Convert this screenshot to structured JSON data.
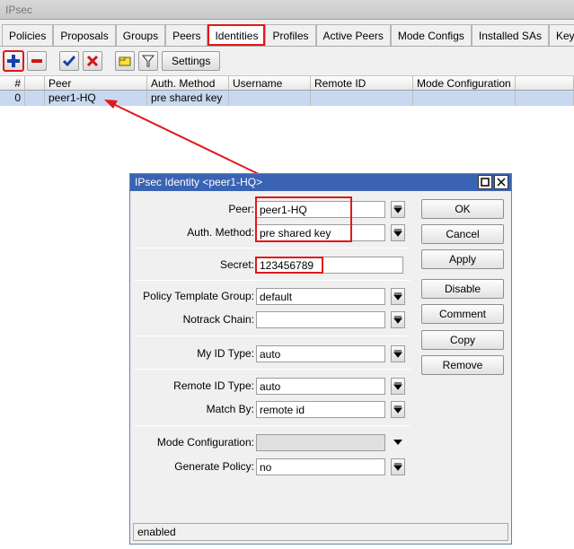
{
  "window": {
    "title": "IPsec"
  },
  "tabs": [
    {
      "label": "Policies",
      "active": false
    },
    {
      "label": "Proposals",
      "active": false
    },
    {
      "label": "Groups",
      "active": false
    },
    {
      "label": "Peers",
      "active": false
    },
    {
      "label": "Identities",
      "active": true
    },
    {
      "label": "Profiles",
      "active": false
    },
    {
      "label": "Active Peers",
      "active": false
    },
    {
      "label": "Mode Configs",
      "active": false
    },
    {
      "label": "Installed SAs",
      "active": false
    },
    {
      "label": "Keys",
      "active": false
    }
  ],
  "toolbar": {
    "add_icon": "plus-icon",
    "remove_icon": "minus-icon",
    "enable_icon": "check-icon",
    "disable_icon": "x-icon",
    "comment_icon": "note-icon",
    "filter_icon": "filter-icon",
    "settings_label": "Settings"
  },
  "table": {
    "columns": [
      "#",
      "",
      "Peer",
      "Auth. Method",
      "Username",
      "Remote ID",
      "Mode Configuration",
      ""
    ],
    "rows": [
      {
        "num": "0",
        "flag": "",
        "peer": "peer1-HQ",
        "auth": "pre shared key",
        "username": "",
        "remote_id": "",
        "mode_config": "",
        "extra": ""
      }
    ]
  },
  "dialog": {
    "title": "IPsec Identity <peer1-HQ>",
    "fields": {
      "peer": {
        "label": "Peer:",
        "value": "peer1-HQ"
      },
      "auth_method": {
        "label": "Auth. Method:",
        "value": "pre shared key"
      },
      "secret": {
        "label": "Secret:",
        "value": "123456789"
      },
      "policy_template_group": {
        "label": "Policy Template Group:",
        "value": "default"
      },
      "notrack_chain": {
        "label": "Notrack Chain:",
        "value": ""
      },
      "my_id_type": {
        "label": "My ID Type:",
        "value": "auto"
      },
      "remote_id_type": {
        "label": "Remote ID Type:",
        "value": "auto"
      },
      "match_by": {
        "label": "Match By:",
        "value": "remote id"
      },
      "mode_configuration": {
        "label": "Mode Configuration:",
        "value": ""
      },
      "generate_policy": {
        "label": "Generate Policy:",
        "value": "no"
      }
    },
    "buttons": {
      "ok": "OK",
      "cancel": "Cancel",
      "apply": "Apply",
      "disable": "Disable",
      "comment": "Comment",
      "copy": "Copy",
      "remove": "Remove"
    },
    "status": "enabled"
  },
  "colors": {
    "highlight": "#e01818",
    "selection": "#c8d8f0",
    "dialog_title": "#3a63b3"
  }
}
